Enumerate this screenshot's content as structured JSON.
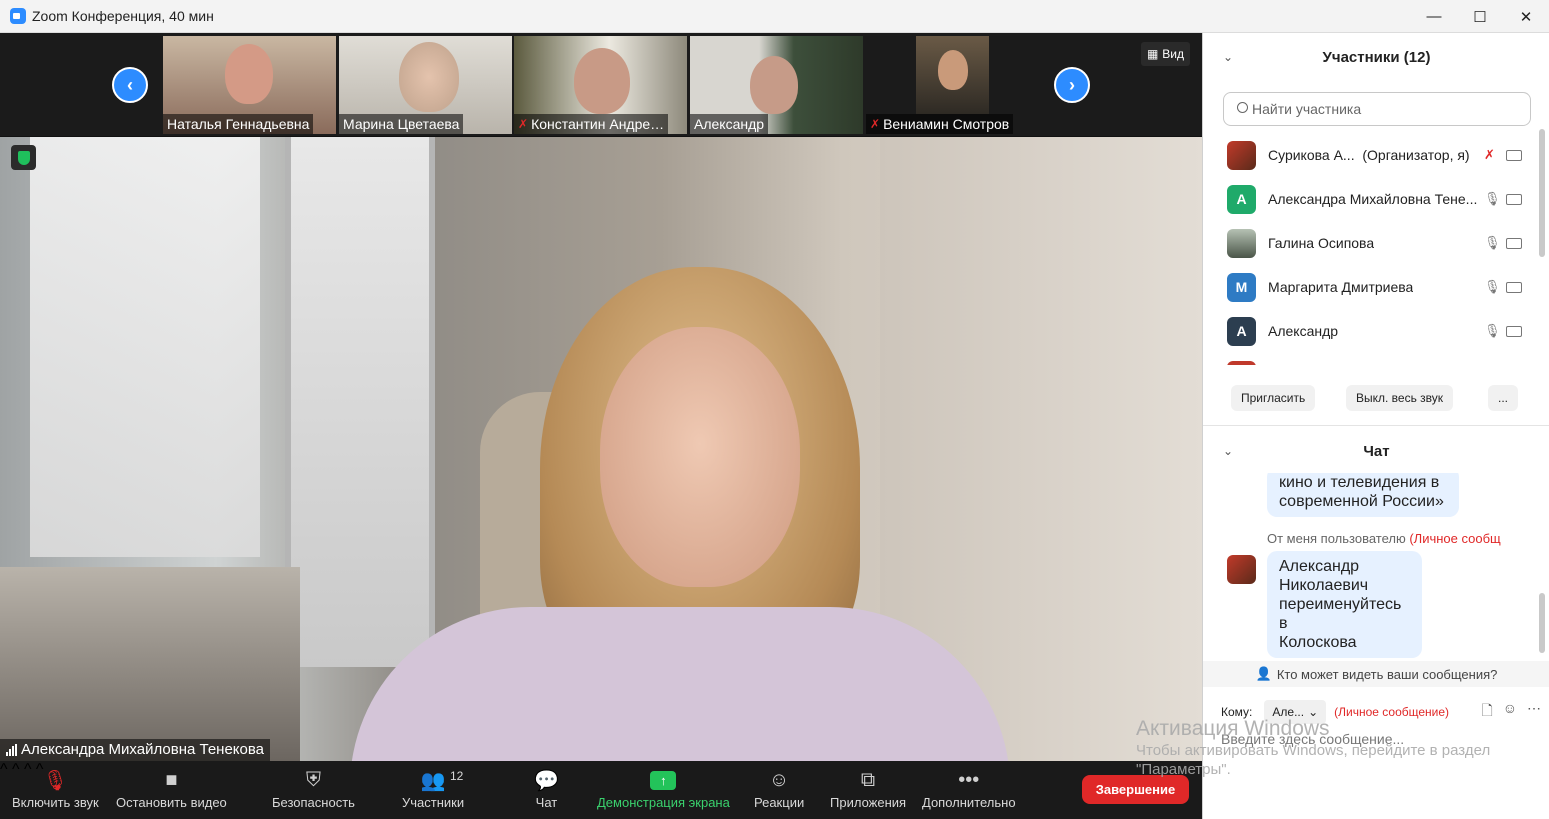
{
  "window": {
    "title": "Zoom Конференция, 40 мин",
    "controls": {
      "minimize": "—",
      "maximize": "☐",
      "close": "✕"
    }
  },
  "gallery": {
    "view_label": "Вид",
    "thumbnails": [
      {
        "name": "Наталья Геннадьевна",
        "muted": false
      },
      {
        "name": "Марина Цветаева",
        "muted": false
      },
      {
        "name": "Константин Андре…",
        "muted": true
      },
      {
        "name": "Александр",
        "muted": false
      },
      {
        "name": "Вениамин Смотров",
        "muted": true
      }
    ]
  },
  "speaker": {
    "name": "Александра Михайловна Тенекова"
  },
  "toolbar": {
    "unmute": "Включить звук",
    "stop_video": "Остановить видео",
    "security": "Безопасность",
    "participants": "Участники",
    "participants_count": "12",
    "chat": "Чат",
    "share_screen": "Демонстрация экрана",
    "reactions": "Реакции",
    "apps": "Приложения",
    "more": "Дополнительно",
    "end": "Завершение"
  },
  "participants_panel": {
    "title": "Участники (12)",
    "search_placeholder": "Найти участника",
    "list": [
      {
        "name": "Сурикова А...",
        "suffix": "(Организатор, я)",
        "avatar_letter": "",
        "avatar_color": "#b23a2a",
        "muted": true
      },
      {
        "name": "Александра Михайловна Тене...",
        "suffix": "",
        "avatar_letter": "A",
        "avatar_color": "#1faa6a",
        "muted": false
      },
      {
        "name": "Галина Осипова",
        "suffix": "",
        "avatar_letter": "",
        "avatar_color": "#6b7a6a",
        "muted": false
      },
      {
        "name": "Маргарита Дмитриева",
        "suffix": "",
        "avatar_letter": "M",
        "avatar_color": "#2e7bc4",
        "muted": false
      },
      {
        "name": "Александр",
        "suffix": "",
        "avatar_letter": "A",
        "avatar_color": "#2c3e50",
        "muted": false
      }
    ],
    "buttons": {
      "invite": "Пригласить",
      "mute_all": "Выкл. весь звук",
      "more": "..."
    }
  },
  "chat_panel": {
    "title": "Чат",
    "messages": [
      {
        "text_line1": "кино и телевидения в",
        "text_line2": "современной России»"
      },
      {
        "from": "От меня пользователю",
        "private_tag": "(Личное сообщ",
        "text": [
          "Александр",
          "Николаевич",
          "переименуйтесь в",
          "Колоскова"
        ]
      }
    ],
    "who_can_see": "Кто может видеть ваши сообщения?",
    "to_label": "Кому:",
    "to_value": "Але...",
    "to_private": "(Личное сообщение)",
    "input_placeholder": "Введите здесь сообщение..."
  },
  "activation_watermark": {
    "line1": "Активация Windows",
    "line2": "Чтобы активировать Windows, перейдите в раздел",
    "line3": "\"Параметры\"."
  }
}
